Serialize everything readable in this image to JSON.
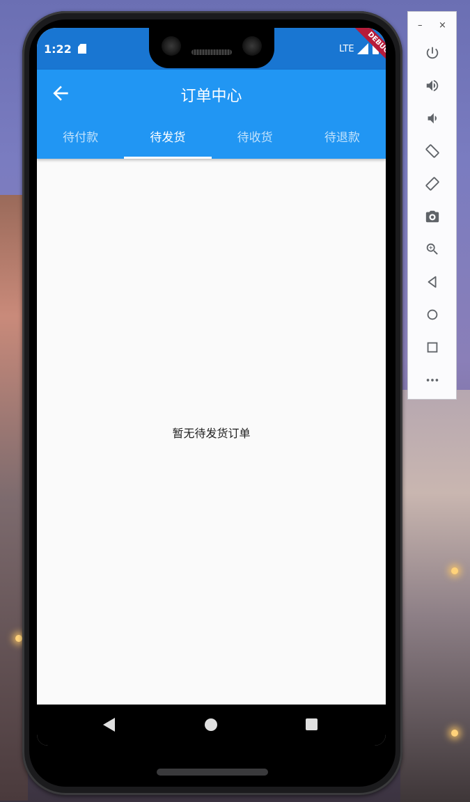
{
  "status": {
    "time": "1:22",
    "network": "LTE",
    "debug_banner": "DEBUG"
  },
  "app": {
    "title": "订单中心",
    "back_icon": "arrow-back-icon"
  },
  "tabs": [
    {
      "label": "待付款",
      "active": false
    },
    {
      "label": "待发货",
      "active": true
    },
    {
      "label": "待收货",
      "active": false
    },
    {
      "label": "待退款",
      "active": false
    }
  ],
  "content": {
    "empty_message": "暂无待发货订单"
  },
  "navigation": [
    "back-triangle-icon",
    "home-circle-icon",
    "recent-apps-square-icon"
  ],
  "emulator_toolbar": {
    "window_controls": [
      "–",
      "×"
    ],
    "tools": [
      "power-icon",
      "volume-up-icon",
      "volume-down-icon",
      "rotate-left-icon",
      "rotate-right-icon",
      "camera-icon",
      "zoom-icon",
      "back-icon",
      "home-icon",
      "overview-icon",
      "more-icon"
    ]
  },
  "colors": {
    "statusbar": "#1976d2",
    "appbar": "#2196f3",
    "debug_banner": "#b71c3a",
    "background": "#fafafa"
  }
}
